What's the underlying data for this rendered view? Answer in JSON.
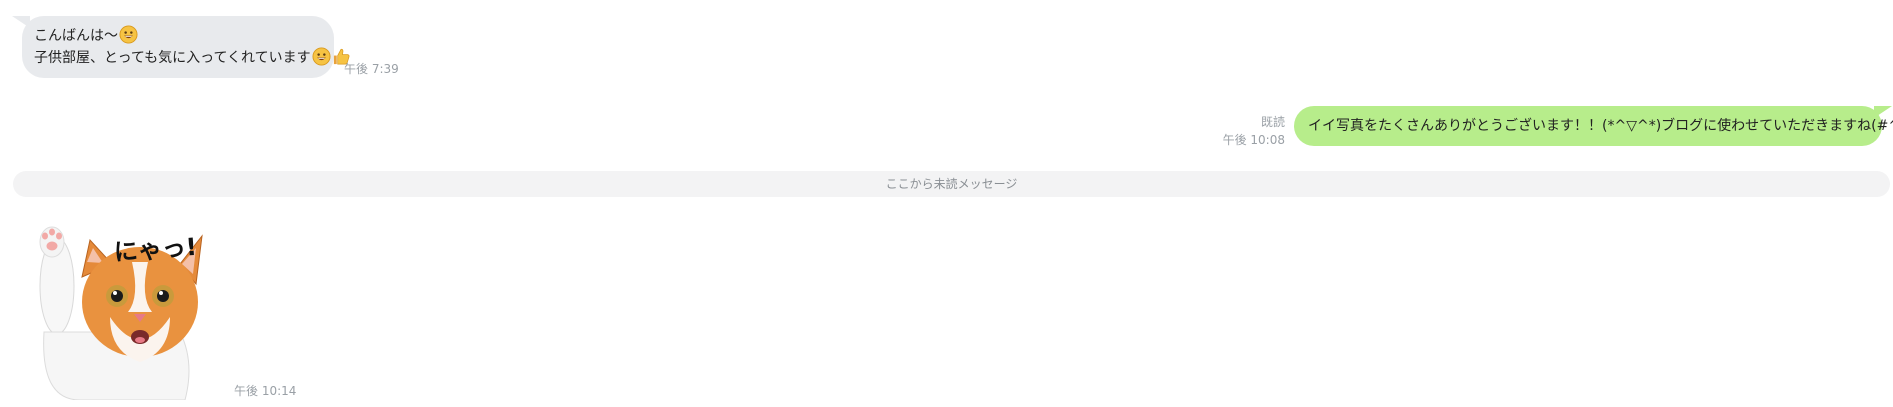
{
  "messages": {
    "incoming1": {
      "line1": "こんばんは～",
      "line2": "子供部屋、とっても気に入ってくれています",
      "time": "午後 7:39",
      "emojis": [
        "grinning-face-icon",
        "grinning-face-icon",
        "thumbs-up-icon"
      ]
    },
    "outgoing1": {
      "text": "イイ写真をたくさんありがとうございます！！(*^▽^*)ブログに使わせていただきますね(#^^#)",
      "read": "既読",
      "time": "午後 10:08"
    },
    "divider": {
      "label": "ここから未読メッセージ"
    },
    "incoming2": {
      "sticker_text": "にゃっ!",
      "sticker_icon": "cat-sticker-icon",
      "time": "午後 10:14"
    }
  },
  "colors": {
    "incoming_bubble": "#e8eaed",
    "outgoing_bubble": "#b7ed8b",
    "divider_bg": "#f3f3f4",
    "meta_text": "#9aa0a6"
  }
}
